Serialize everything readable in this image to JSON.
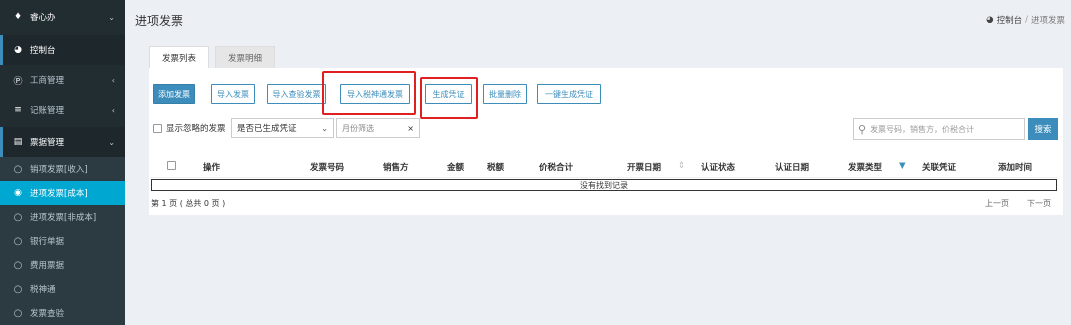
{
  "sidebar": {
    "brand": {
      "icon": "diamond-icon",
      "label": "睿心办"
    },
    "items": [
      {
        "icon": "dashboard-icon",
        "label": "控制台"
      },
      {
        "icon": "p-circle-icon",
        "label": "工商管理"
      },
      {
        "icon": "list-icon",
        "label": "记账管理"
      },
      {
        "icon": "receipt-icon",
        "label": "票据管理"
      }
    ],
    "subitems": [
      {
        "icon": "circle-icon",
        "label": "销项发票[收入]"
      },
      {
        "icon": "dot-circle-icon",
        "label": "进项发票[成本]"
      },
      {
        "icon": "circle-icon",
        "label": "进项发票[非成本]"
      },
      {
        "icon": "circle-icon",
        "label": "银行单据"
      },
      {
        "icon": "circle-icon",
        "label": "费用票据"
      },
      {
        "icon": "circle-icon",
        "label": "税神通"
      },
      {
        "icon": "circle-icon",
        "label": "发票查验"
      }
    ]
  },
  "header": {
    "title": "进项发票",
    "breadcrumb": {
      "home_icon": "dashboard-icon",
      "home": "控制台",
      "sep": "/",
      "current": "进项发票"
    }
  },
  "tabs": [
    "发票列表",
    "发票明细"
  ],
  "toolbar": {
    "add": "添加发票",
    "import": "导入发票",
    "import_check": "导入查验发票",
    "import_ssft": "导入税神通发票",
    "gen_voucher": "生成凭证",
    "batch_delete": "批量删除",
    "one_click": "一键生成凭证"
  },
  "filters": {
    "show_ignored": "显示忽略的发票",
    "voucher_select": "是否已生成凭证",
    "month_placeholder": "月份筛选",
    "month_clear": "×",
    "search_placeholder": "发票号码，销售方，价税合计",
    "search_button": "搜索"
  },
  "table": {
    "columns": [
      "操作",
      "发票号码",
      "销售方",
      "金额",
      "税额",
      "价税合计",
      "开票日期",
      "认证状态",
      "认证日期",
      "发票类型",
      "关联凭证",
      "添加时间"
    ],
    "empty": "没有找到记录"
  },
  "pagination": {
    "info": "第 1 页 ( 总共 0 页 )",
    "prev": "上一页",
    "next": "下一页"
  },
  "colors": {
    "accent": "#3c8dbc",
    "sidebar": "#222d32",
    "highlight": "#e02020"
  }
}
